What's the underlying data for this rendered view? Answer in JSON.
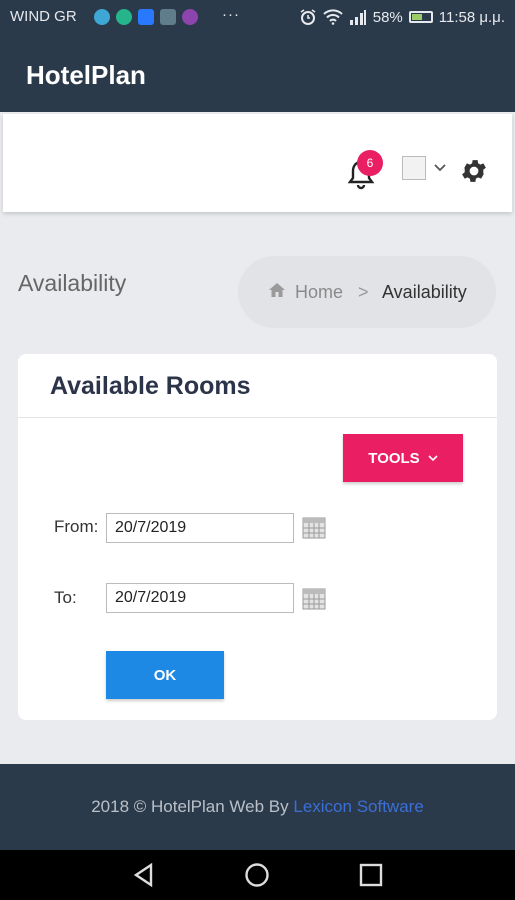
{
  "status_bar": {
    "carrier": "WIND GR",
    "more": "···",
    "battery_percent": "58%",
    "battery_level": 0.58,
    "time": "11:58 μ.μ.",
    "icons": [
      "moon-icon",
      "circle-app-icon",
      "blue-app-icon",
      "gallery-icon",
      "purple-app-icon",
      "alarm-icon",
      "wifi-icon",
      "signal-icon",
      "battery-icon"
    ]
  },
  "app_bar": {
    "title": "HotelPlan"
  },
  "top_nav": {
    "notification_count": "6"
  },
  "page": {
    "title": "Availability"
  },
  "breadcrumb": {
    "home": "Home",
    "separator": ">",
    "current": "Availability"
  },
  "card": {
    "title": "Available Rooms",
    "tools_label": "TOOLS",
    "from_label": "From:",
    "from_value": "20/7/2019",
    "to_label": "To:",
    "to_value": "20/7/2019",
    "ok_label": "OK"
  },
  "footer": {
    "text": "2018 © HotelPlan Web By",
    "link": "Lexicon Software"
  },
  "colors": {
    "header_bg": "#2b3a4a",
    "accent_pink": "#e91e63",
    "primary_blue": "#1e88e5",
    "link_blue": "#3a6fd8",
    "page_bg": "#e9ebee"
  }
}
